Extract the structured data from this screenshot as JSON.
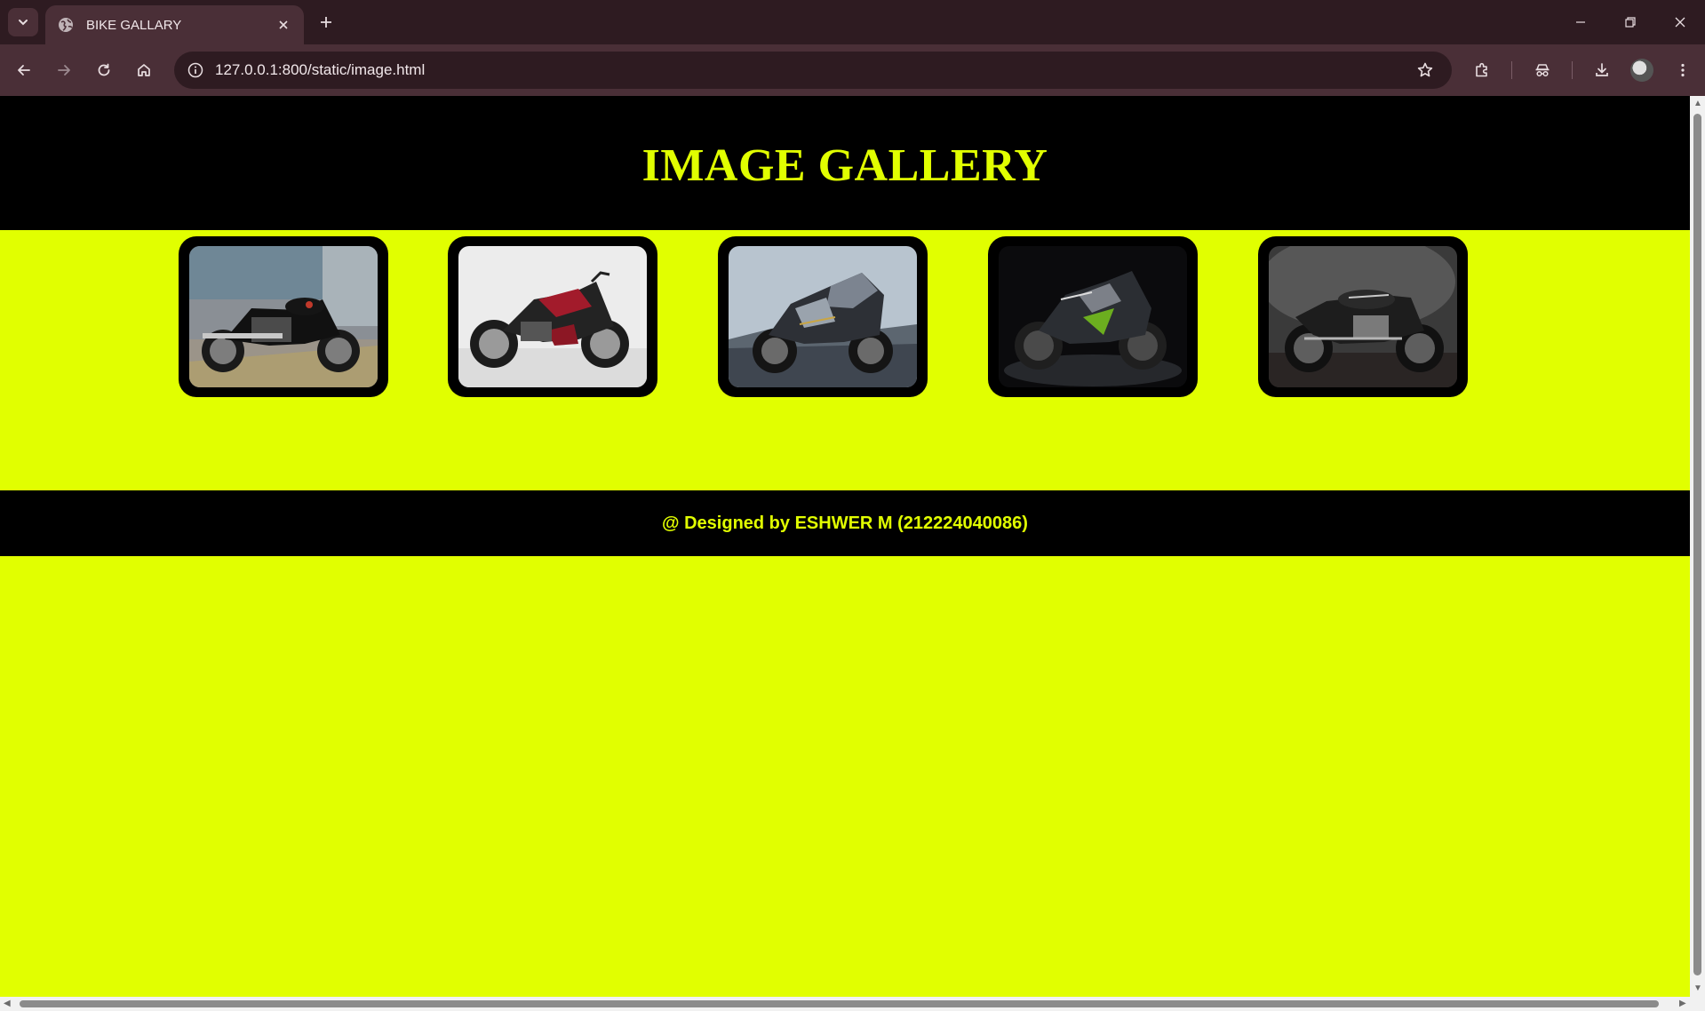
{
  "browser": {
    "tab_title": "BIKE GALLARY",
    "url": "127.0.0.1:800/static/image.html"
  },
  "icons": {
    "tab_search": "chevron-down-icon",
    "favicon": "globe-icon",
    "tab_close": "close-icon",
    "new_tab": "plus-icon",
    "back": "arrow-left-icon",
    "forward": "arrow-right-icon",
    "reload": "reload-icon",
    "home": "home-icon",
    "site_info": "info-icon",
    "bookmark": "star-icon",
    "extensions": "puzzle-icon",
    "incognito": "incognito-icon",
    "downloads": "download-icon",
    "menu": "kebab-menu-icon"
  },
  "page": {
    "title": "IMAGE GALLERY",
    "footer": "@ Designed by ESHWER M (212224040086)",
    "gallery": [
      {
        "id": "classic-bike"
      },
      {
        "id": "red-naked-bike"
      },
      {
        "id": "sport-bike"
      },
      {
        "id": "green-black-naked-bike"
      },
      {
        "id": "cafe-racer-bike"
      }
    ]
  },
  "colors": {
    "accent": "#e1ff00",
    "header_bg": "#000000",
    "frame_bg": "#000000",
    "browser_chrome": "#4a2f37"
  }
}
